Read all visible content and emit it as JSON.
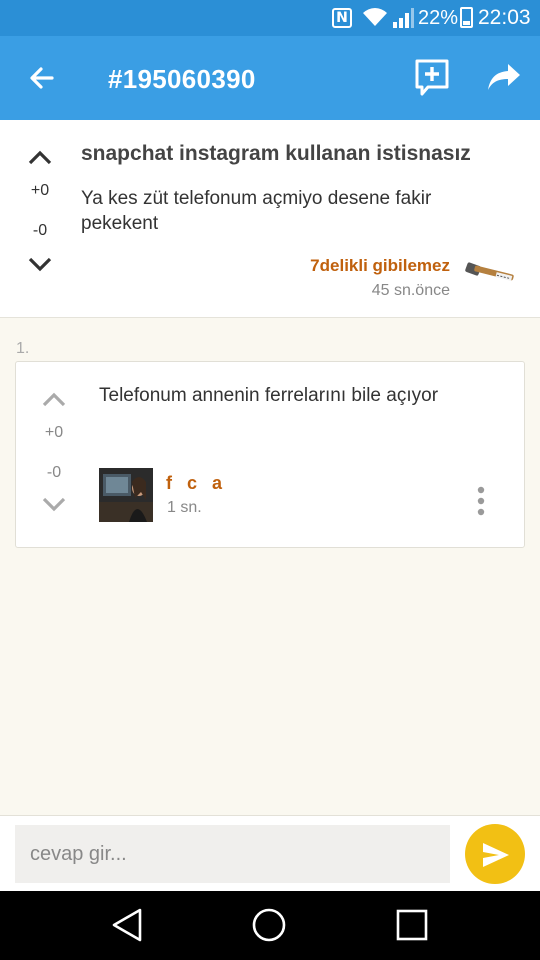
{
  "status_bar": {
    "nfc": "N",
    "battery_percent": "22%",
    "time": "22:03",
    "icons": [
      "nfc-icon",
      "wifi-icon",
      "signal-icon",
      "battery-icon"
    ]
  },
  "app_bar": {
    "title": "#195060390",
    "icons": [
      "back-arrow-icon",
      "add-comment-icon",
      "share-icon"
    ]
  },
  "entry": {
    "topic": "snapchat instagram kullanan istisnasız",
    "text": "Ya kes züt telefonum açmiyo desene fakir pekekent",
    "upvotes": "+0",
    "downvotes": "-0",
    "author": "7delikli gibilemez",
    "time": "45 sn.önce",
    "avatar_icon": "hammer-icon"
  },
  "replies": [
    {
      "index": "1.",
      "text": "Telefonum annenin ferrelarını bile açıyor",
      "upvotes": "+0",
      "downvotes": "-0",
      "author": "f c a",
      "time": "1 sn."
    }
  ],
  "composer": {
    "placeholder": "cevap gir...",
    "send_icon": "send-icon"
  },
  "nav_bar": {
    "icons": [
      "nav-back-icon",
      "nav-home-icon",
      "nav-recents-icon"
    ]
  },
  "colors": {
    "status_bar": "#2b8fd6",
    "app_bar": "#3a9ee4",
    "author": "#c0610e",
    "send_button": "#f2c014",
    "background": "#faf8f0"
  }
}
